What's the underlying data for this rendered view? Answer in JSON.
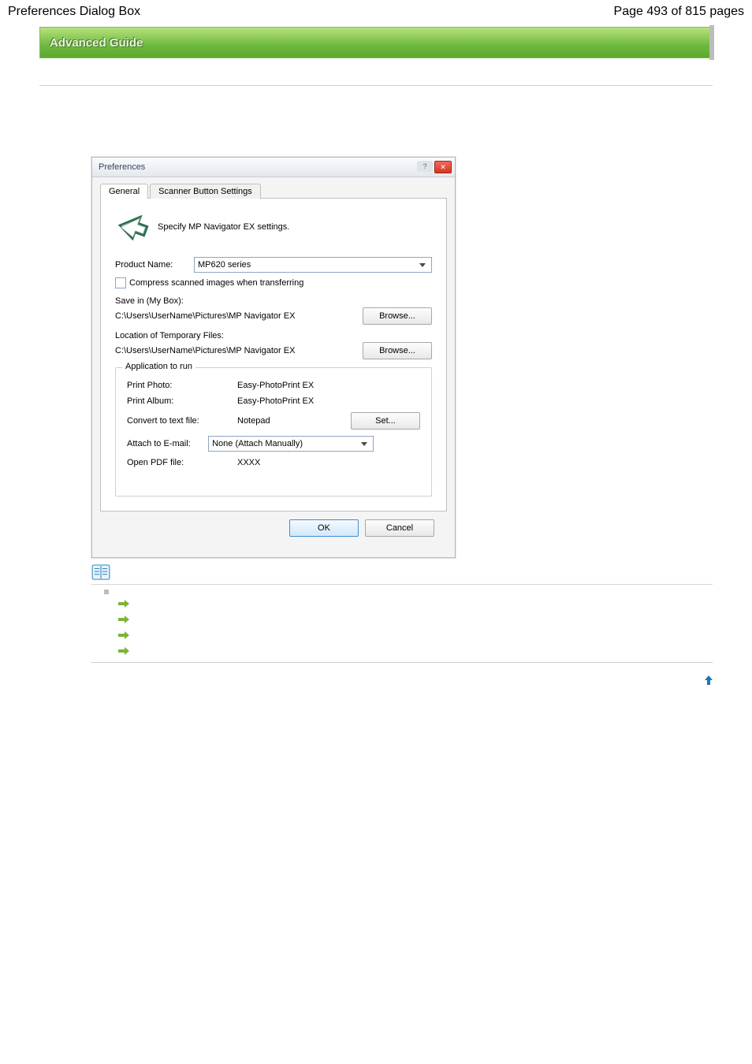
{
  "header": {
    "titleLeft": "Preferences Dialog Box",
    "titleRight": "Page 493 of 815 pages"
  },
  "guide": {
    "title": "Advanced Guide"
  },
  "dialog": {
    "title": "Preferences",
    "tabs": {
      "general": "General",
      "scanner": "Scanner Button Settings"
    },
    "intro": "Specify MP Navigator EX settings.",
    "productName": {
      "label": "Product Name:",
      "value": "MP620 series"
    },
    "compress": "Compress scanned images when transferring",
    "saveIn": {
      "label": "Save in (My Box):",
      "path": "C:\\Users\\UserName\\Pictures\\MP Navigator EX"
    },
    "tempFiles": {
      "label": "Location of Temporary Files:",
      "path": "C:\\Users\\UserName\\Pictures\\MP Navigator EX"
    },
    "browse": "Browse...",
    "appGroup": {
      "legend": "Application to run",
      "rows": [
        {
          "label": "Print Photo:",
          "value": "Easy-PhotoPrint EX"
        },
        {
          "label": "Print Album:",
          "value": "Easy-PhotoPrint EX"
        },
        {
          "label": "Convert to text file:",
          "value": "Notepad",
          "action": "Set..."
        },
        {
          "label": "Attach to E-mail:",
          "value": "None (Attach Manually)",
          "dropdown": true
        },
        {
          "label": "Open PDF file:",
          "value": "XXXX"
        }
      ]
    },
    "footer": {
      "ok": "OK",
      "cancel": "Cancel"
    }
  },
  "icons": {
    "winMin": "window-minimize-icon",
    "winClose": "window-close-icon",
    "scan": "scan-arrow-icon",
    "note": "manual-icon",
    "arrow": "right-arrow-icon",
    "top": "up-arrow-icon"
  }
}
